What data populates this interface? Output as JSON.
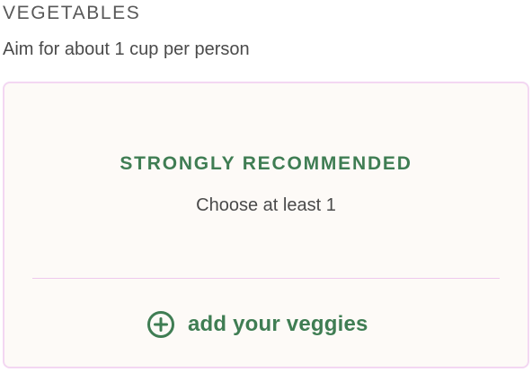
{
  "section": {
    "heading": "VEGETABLES",
    "subtitle": "Aim for about 1 cup per person"
  },
  "card": {
    "tag": "STRONGLY RECOMMENDED",
    "instruction": "Choose at least 1",
    "add_button": {
      "label": "add your veggies",
      "icon": "plus-circle-icon"
    }
  },
  "colors": {
    "accent_green": "#3f7d53",
    "card_border": "#f3d7f2",
    "card_background": "#fdfaf7",
    "divider": "#efc9ee",
    "heading_text": "#585858",
    "body_text": "#4a4a4a"
  }
}
